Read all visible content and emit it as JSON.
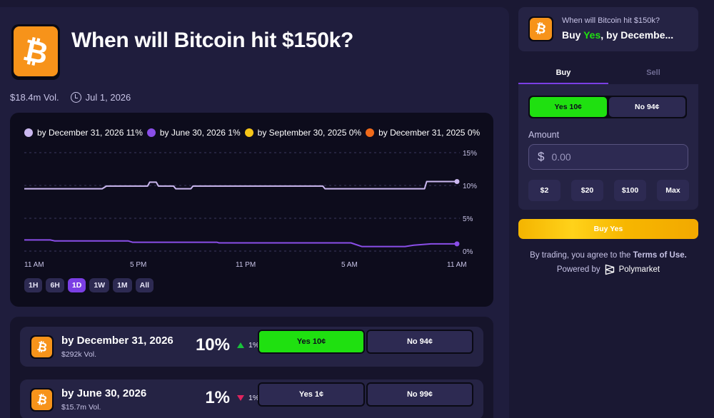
{
  "header": {
    "title": "When will Bitcoin hit $150k?",
    "logo_glyph": "₿",
    "volume": "$18.4m Vol.",
    "end_date": "Jul 1, 2026",
    "logo_icon": "bitcoin-icon",
    "date_icon": "clock-icon"
  },
  "chart_data": {
    "type": "line",
    "legend": [
      {
        "label": "by December 31, 2026 11%",
        "color": "#cbb8f0"
      },
      {
        "label": "by June 30, 2026 1%",
        "color": "#8a4ee8"
      },
      {
        "label": "by September 30, 2025 0%",
        "color": "#f5c518"
      },
      {
        "label": "by December 31, 2025 0%",
        "color": "#f06a1a"
      }
    ],
    "x_ticks": [
      "11 AM",
      "5 PM",
      "11 PM",
      "5 AM",
      "11 AM"
    ],
    "y_ticks": [
      "15%",
      "10%",
      "5%",
      "0%"
    ],
    "ylim": [
      0,
      15
    ],
    "grid": true,
    "series": [
      {
        "name": "by December 31, 2026",
        "color": "#cbb8f0",
        "x": [
          0,
          0.18,
          0.19,
          0.285,
          0.29,
          0.305,
          0.31,
          0.345,
          0.35,
          0.385,
          0.39,
          0.69,
          0.695,
          0.925,
          0.93,
          1.0
        ],
        "values": [
          9.5,
          9.5,
          9.9,
          9.9,
          10.5,
          10.5,
          9.9,
          9.9,
          9.5,
          9.5,
          9.9,
          9.9,
          9.5,
          9.5,
          10.6,
          10.6
        ]
      },
      {
        "name": "by June 30, 2026",
        "color": "#8a4ee8",
        "x": [
          0,
          0.06,
          0.07,
          0.24,
          0.25,
          0.35,
          0.445,
          0.45,
          0.755,
          0.78,
          0.88,
          0.9,
          0.94,
          1.0
        ],
        "values": [
          1.7,
          1.7,
          1.55,
          1.55,
          1.35,
          1.35,
          1.35,
          1.25,
          1.25,
          0.7,
          0.7,
          0.9,
          1.1,
          1.1
        ]
      }
    ]
  },
  "range_buttons": [
    "1H",
    "6H",
    "1D",
    "1W",
    "1M",
    "All"
  ],
  "range_active": "1D",
  "outcomes": [
    {
      "title": "by December 31, 2026",
      "volume": "$292k Vol.",
      "pct": "10%",
      "change": "1%",
      "direction": "up",
      "yes_label": "Yes 10¢",
      "no_label": "No 94¢",
      "selected": true
    },
    {
      "title": "by June 30, 2026",
      "volume": "$15.7m Vol.",
      "pct": "1%",
      "change": "1%",
      "direction": "down",
      "yes_label": "Yes 1¢",
      "no_label": "No 99¢",
      "selected": false
    }
  ],
  "trade": {
    "question": "When will Bitcoin hit $150k?",
    "selection_prefix": "Buy ",
    "selection_yes": "Yes",
    "selection_suffix": ", by Decembe...",
    "tab_buy": "Buy",
    "tab_sell": "Sell",
    "yes_label": "Yes 10¢",
    "no_label": "No 94¢",
    "amount_label": "Amount",
    "currency_symbol": "$",
    "amount_placeholder": "0.00",
    "quick_amounts": [
      "$2",
      "$20",
      "$100",
      "Max"
    ],
    "buy_button": "Buy Yes",
    "terms_prefix": "By trading, you agree to the ",
    "terms_link": "Terms of Use.",
    "powered_by": "Powered by",
    "brand": "Polymarket",
    "brand_icon": "polymarket-icon"
  },
  "colors": {
    "yes_green": "#1fe010",
    "accent_purple": "#7b3fe4",
    "buy_yellow": "#f5b800",
    "bitcoin_orange": "#f7931a"
  }
}
